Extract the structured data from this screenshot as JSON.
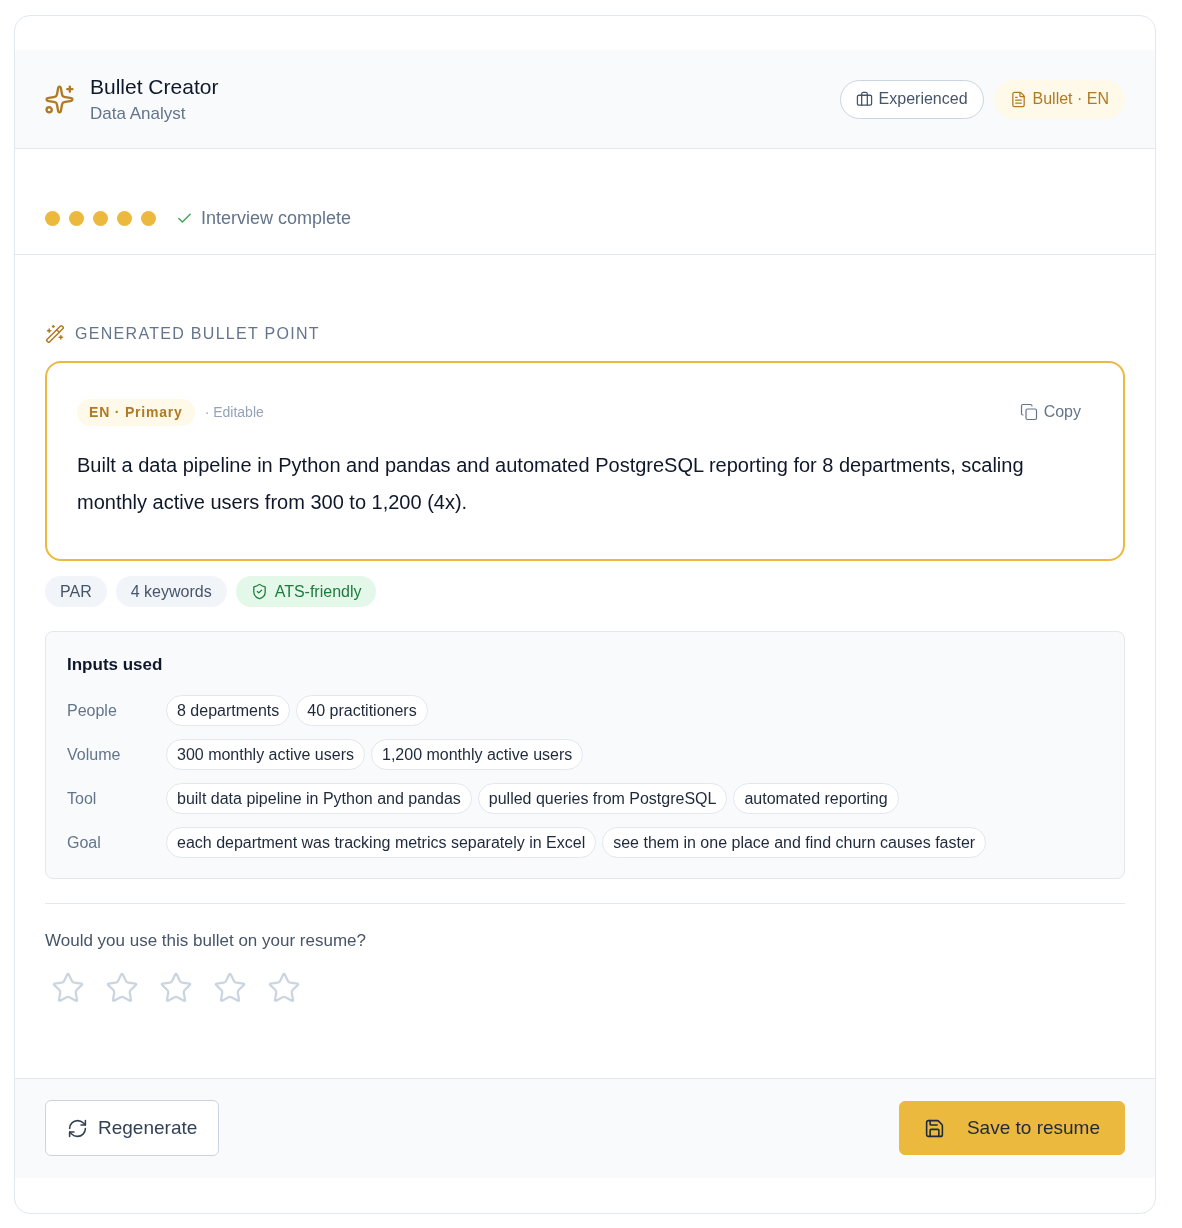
{
  "header": {
    "title": "Bullet Creator",
    "subtitle": "Data Analyst",
    "badges": [
      {
        "kind": "outline",
        "label": "Experienced"
      },
      {
        "kind": "accent",
        "label": "Bullet · EN"
      }
    ]
  },
  "progress": {
    "steps": [
      {
        "done": true
      },
      {
        "done": true
      },
      {
        "done": true
      },
      {
        "done": true
      },
      {
        "done": true
      }
    ],
    "status": "Interview complete"
  },
  "bullet": {
    "section_label": "GENERATED BULLET POINT",
    "language_badge": "EN · Primary",
    "note": "· Editable",
    "copy_label": "Copy",
    "text": "Built a data pipeline in Python and pandas and automated PostgreSQL reporting for 8 departments, scaling monthly active users from 300 to 1,200 (4x)."
  },
  "tags": [
    {
      "kind": "neutral",
      "label": "PAR"
    },
    {
      "kind": "neutral",
      "label": "4 keywords"
    },
    {
      "kind": "success",
      "label": "ATS-friendly"
    }
  ],
  "inputs": {
    "title": "Inputs used",
    "rows": [
      {
        "label": "People",
        "values": [
          "8 departments",
          "40 practitioners"
        ]
      },
      {
        "label": "Volume",
        "values": [
          "300 monthly active users",
          "1,200 monthly active users"
        ]
      },
      {
        "label": "Tool",
        "values": [
          "built data pipeline in Python and pandas",
          "pulled queries from PostgreSQL",
          "automated reporting"
        ]
      },
      {
        "label": "Goal",
        "values": [
          "each department was tracking metrics separately in Excel",
          "see them in one place and find churn causes faster"
        ]
      }
    ]
  },
  "rating": {
    "question": "Would you use this bullet on your resume?",
    "stars": 0
  },
  "footer": {
    "buttons": [
      {
        "kind": "secondary",
        "label": "Regenerate"
      },
      {
        "kind": "primary",
        "label": "Save to resume"
      }
    ]
  }
}
